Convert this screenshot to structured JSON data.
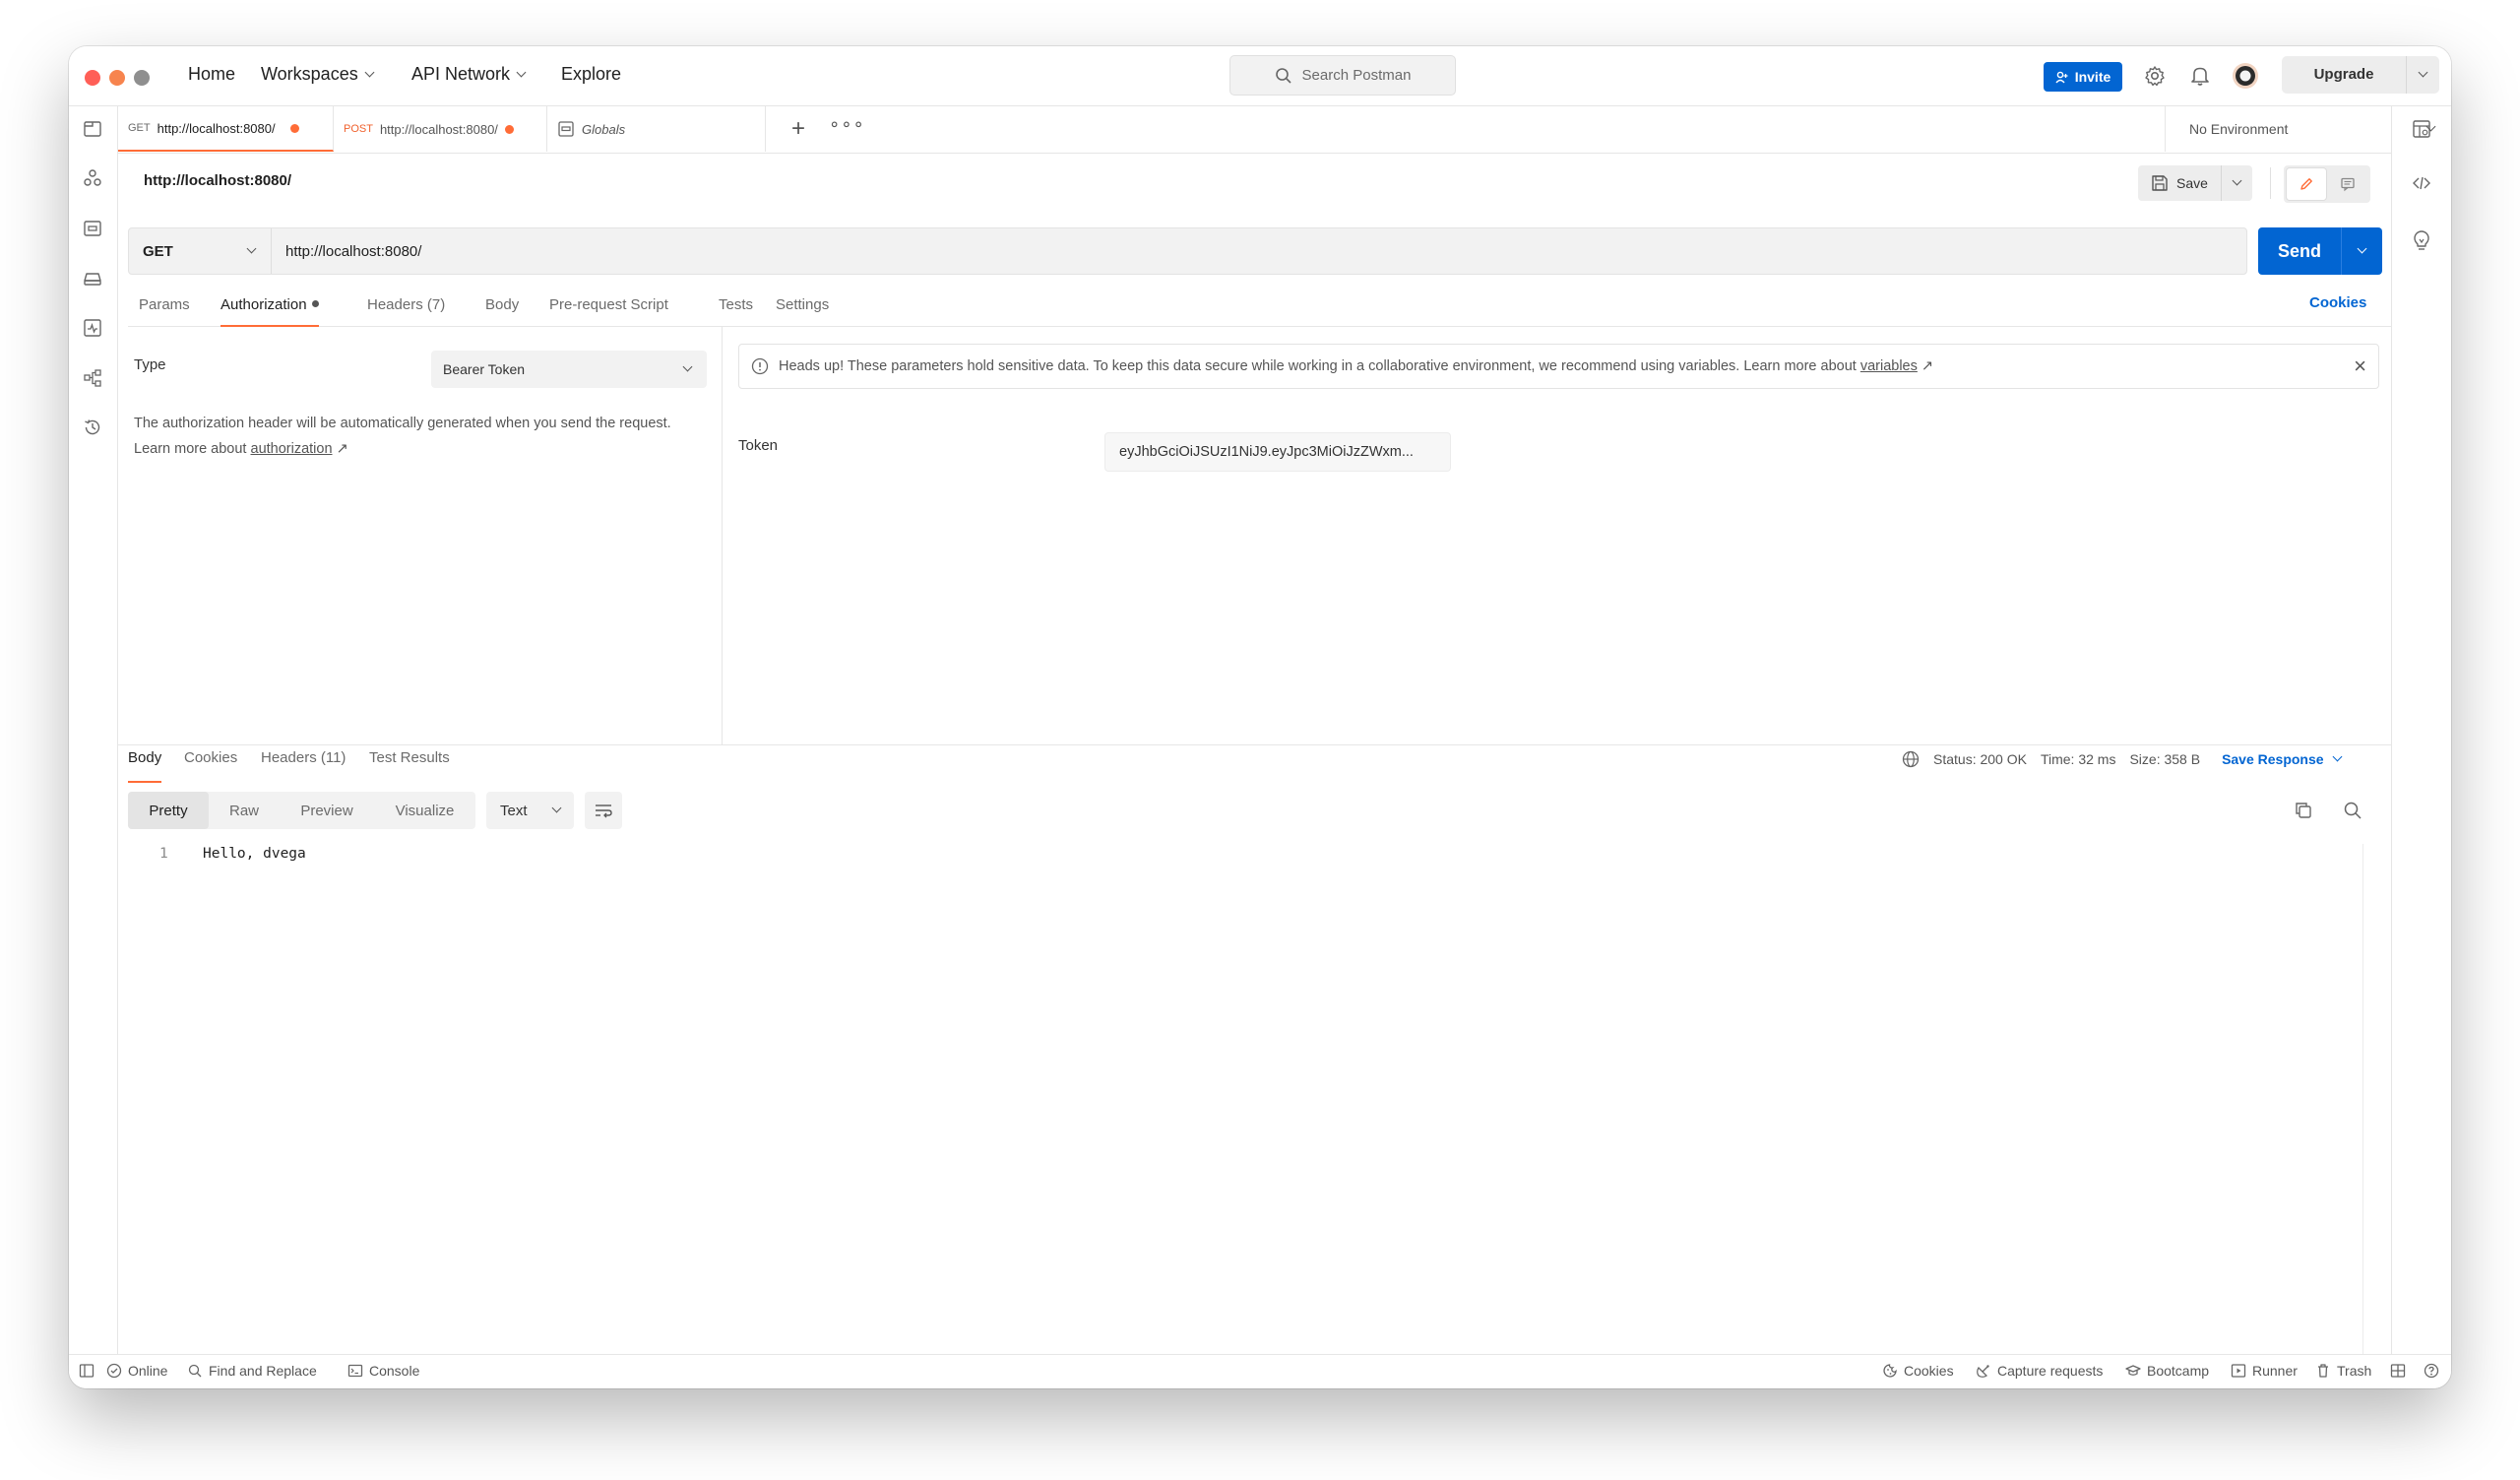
{
  "titlebar": {
    "nav": [
      "Home",
      "Workspaces",
      "API Network",
      "Explore"
    ],
    "search_placeholder": "Search Postman",
    "invite_label": "Invite",
    "upgrade_label": "Upgrade"
  },
  "tabs": [
    {
      "method": "GET",
      "url": "http://localhost:8080/"
    },
    {
      "method": "POST",
      "url": "http://localhost:8080/"
    },
    {
      "label": "Globals"
    }
  ],
  "environment": "No Environment",
  "request": {
    "title": "http://localhost:8080/",
    "save_label": "Save",
    "method": "GET",
    "url": "http://localhost:8080/",
    "send_label": "Send",
    "tabs": [
      "Params",
      "Authorization",
      "Headers (7)",
      "Body",
      "Pre-request Script",
      "Tests",
      "Settings"
    ],
    "cookies_label": "Cookies"
  },
  "auth": {
    "type_label": "Type",
    "type_value": "Bearer Token",
    "desc_prefix": "The authorization header will be automatically generated when you send the request. Learn more about ",
    "desc_link": "authorization",
    "alert_text": "Heads up! These parameters hold sensitive data. To keep this data secure while working in a collaborative environment, we recommend using variables. Learn more about ",
    "alert_link": "variables",
    "token_label": "Token",
    "token_value": "eyJhbGciOiJSUzI1NiJ9.eyJpc3MiOiJzZWxm..."
  },
  "response": {
    "tabs": [
      "Body",
      "Cookies",
      "Headers (11)",
      "Test Results"
    ],
    "status": "Status: 200 OK",
    "time": "Time: 32 ms",
    "size": "Size: 358 B",
    "save_response": "Save Response",
    "views": [
      "Pretty",
      "Raw",
      "Preview",
      "Visualize"
    ],
    "format": "Text",
    "lines": [
      {
        "n": "1",
        "text": "Hello, dvega"
      }
    ]
  },
  "footer": {
    "online": "Online",
    "find_replace": "Find and Replace",
    "console": "Console",
    "cookies": "Cookies",
    "capture": "Capture requests",
    "bootcamp": "Bootcamp",
    "runner": "Runner",
    "trash": "Trash"
  },
  "colors": {
    "accent": "#ff6c37",
    "primary": "#0265d2",
    "traffic_red": "#ff5f57",
    "traffic_orange": "#f7844e",
    "traffic_gray": "#8f8f8f"
  }
}
